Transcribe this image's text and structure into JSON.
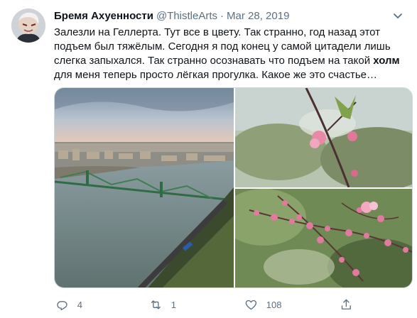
{
  "tweet": {
    "display_name": "Бремя Ахуенности",
    "handle": "@ThistleArts",
    "separator": "·",
    "date": "Mar 28, 2019",
    "text_part1": "Залезли на Геллерта. Тут все в цвету. Так странно, год назад этот подъем был тяжёлым. Сегодня я под конец у самой цитадели лишь слегка запыхался. Так странно осознавать что подъем на такой ",
    "text_bold": "холм",
    "text_part2": " для меня теперь просто лёгкая прогулка. Какое же это счастье…"
  },
  "actions": {
    "reply_count": "4",
    "retweet_count": "1",
    "like_count": "108"
  },
  "icons": {
    "more": "chevron-down-icon",
    "reply": "reply-icon",
    "retweet": "retweet-icon",
    "like": "heart-icon",
    "share": "share-icon"
  },
  "colors": {
    "name": "#0f1419",
    "secondary": "#5b7083",
    "border": "#cfd9de"
  }
}
